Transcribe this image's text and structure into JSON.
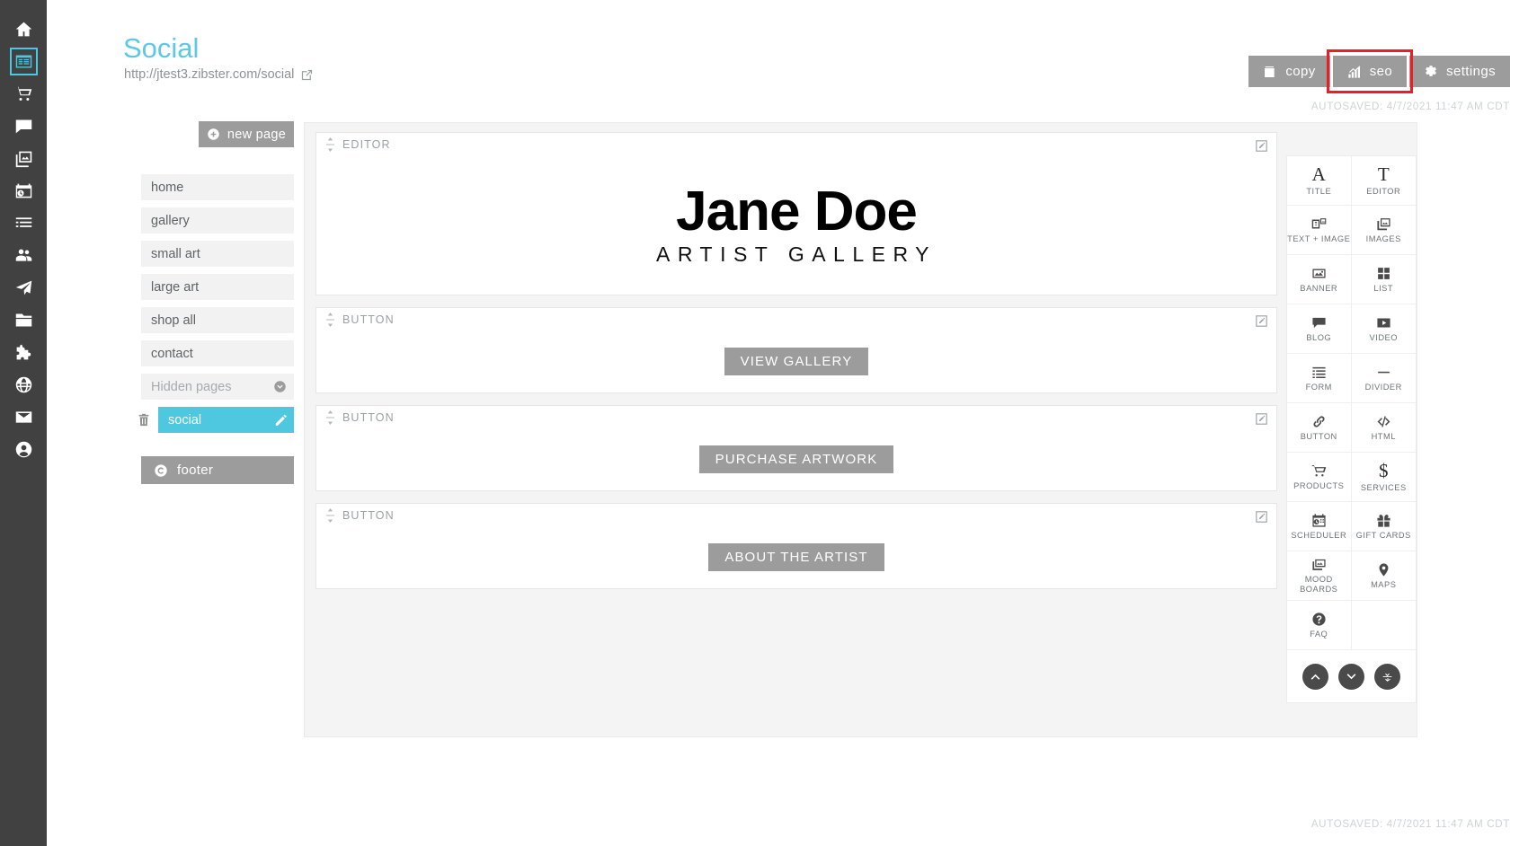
{
  "rail": {
    "items": [
      {
        "name": "home-icon",
        "label": "home",
        "active": false
      },
      {
        "name": "pages-icon",
        "label": "pages",
        "active": true
      },
      {
        "name": "cart-icon",
        "label": "store",
        "active": false
      },
      {
        "name": "comment-icon",
        "label": "comments",
        "active": false
      },
      {
        "name": "gallery-icon",
        "label": "galleries",
        "active": false
      },
      {
        "name": "scheduler-icon",
        "label": "scheduler",
        "active": false
      },
      {
        "name": "list-icon",
        "label": "lists",
        "active": false
      },
      {
        "name": "clients-icon",
        "label": "clients",
        "active": false
      },
      {
        "name": "send-icon",
        "label": "campaigns",
        "active": false
      },
      {
        "name": "folder-icon",
        "label": "files",
        "active": false
      },
      {
        "name": "puzzle-icon",
        "label": "integrations",
        "active": false
      },
      {
        "name": "globe-icon",
        "label": "website",
        "active": false
      },
      {
        "name": "mail-icon",
        "label": "mail",
        "active": false
      },
      {
        "name": "account-icon",
        "label": "account",
        "active": false
      }
    ]
  },
  "header": {
    "title": "Social",
    "url": "http://jtest3.zibster.com/social",
    "share_icon": "share-icon",
    "actions": [
      {
        "label": "copy",
        "icon": "copy-page-icon",
        "highlighted": false
      },
      {
        "label": "seo",
        "icon": "seo-chart-icon",
        "highlighted": true
      },
      {
        "label": "settings",
        "icon": "gear-icon",
        "highlighted": false
      }
    ],
    "autosaved_top": "AUTOSAVED: 4/7/2021 11:47 AM CDT",
    "autosaved_bottom": "AUTOSAVED: 4/7/2021 11:47 AM CDT",
    "accent_color": "#5bc8e8",
    "highlight_color": "#ee1c25"
  },
  "pagelist": {
    "new_page_label": "new page",
    "items": [
      {
        "label": "home",
        "state": "normal"
      },
      {
        "label": "gallery",
        "state": "normal"
      },
      {
        "label": "small art",
        "state": "normal"
      },
      {
        "label": "large art",
        "state": "normal"
      },
      {
        "label": "shop all",
        "state": "normal"
      },
      {
        "label": "contact",
        "state": "normal"
      },
      {
        "label": "Hidden pages",
        "state": "group"
      },
      {
        "label": "social",
        "state": "selected"
      }
    ],
    "footer_label": "footer"
  },
  "canvas": {
    "blocks": [
      {
        "type": "editor",
        "label": "EDITOR",
        "hero_name": "Jane Doe",
        "hero_sub": "ARTIST GALLERY"
      },
      {
        "type": "button",
        "label": "BUTTON",
        "button_text": "VIEW GALLERY"
      },
      {
        "type": "button",
        "label": "BUTTON",
        "button_text": "PURCHASE ARTWORK"
      },
      {
        "type": "button",
        "label": "BUTTON",
        "button_text": "ABOUT THE ARTIST"
      }
    ]
  },
  "widgets": {
    "items": [
      {
        "label": "TITLE",
        "icon": "title-a-icon"
      },
      {
        "label": "EDITOR",
        "icon": "editor-t-icon"
      },
      {
        "label": "TEXT + IMAGE",
        "icon": "text-image-icon"
      },
      {
        "label": "IMAGES",
        "icon": "images-icon"
      },
      {
        "label": "BANNER",
        "icon": "banner-icon"
      },
      {
        "label": "LIST",
        "icon": "grid-list-icon"
      },
      {
        "label": "BLOG",
        "icon": "blog-icon"
      },
      {
        "label": "VIDEO",
        "icon": "video-icon"
      },
      {
        "label": "FORM",
        "icon": "form-icon"
      },
      {
        "label": "DIVIDER",
        "icon": "divider-icon"
      },
      {
        "label": "BUTTON",
        "icon": "link-button-icon"
      },
      {
        "label": "HTML",
        "icon": "code-icon"
      },
      {
        "label": "PRODUCTS",
        "icon": "cart-icon"
      },
      {
        "label": "SERVICES",
        "icon": "dollar-icon"
      },
      {
        "label": "SCHEDULER",
        "icon": "calendar-clock-icon"
      },
      {
        "label": "GIFT CARDS",
        "icon": "gift-icon"
      },
      {
        "label": "MOOD BOARDS",
        "icon": "mood-boards-icon"
      },
      {
        "label": "MAPS",
        "icon": "map-pin-icon"
      },
      {
        "label": "FAQ",
        "icon": "question-icon"
      },
      {
        "label": "",
        "icon": ""
      }
    ],
    "nav": [
      {
        "name": "scroll-up-button",
        "icon": "chevron-up-icon"
      },
      {
        "name": "scroll-down-button",
        "icon": "chevron-down-icon"
      },
      {
        "name": "collapse-all-button",
        "icon": "collapse-icon"
      }
    ]
  }
}
